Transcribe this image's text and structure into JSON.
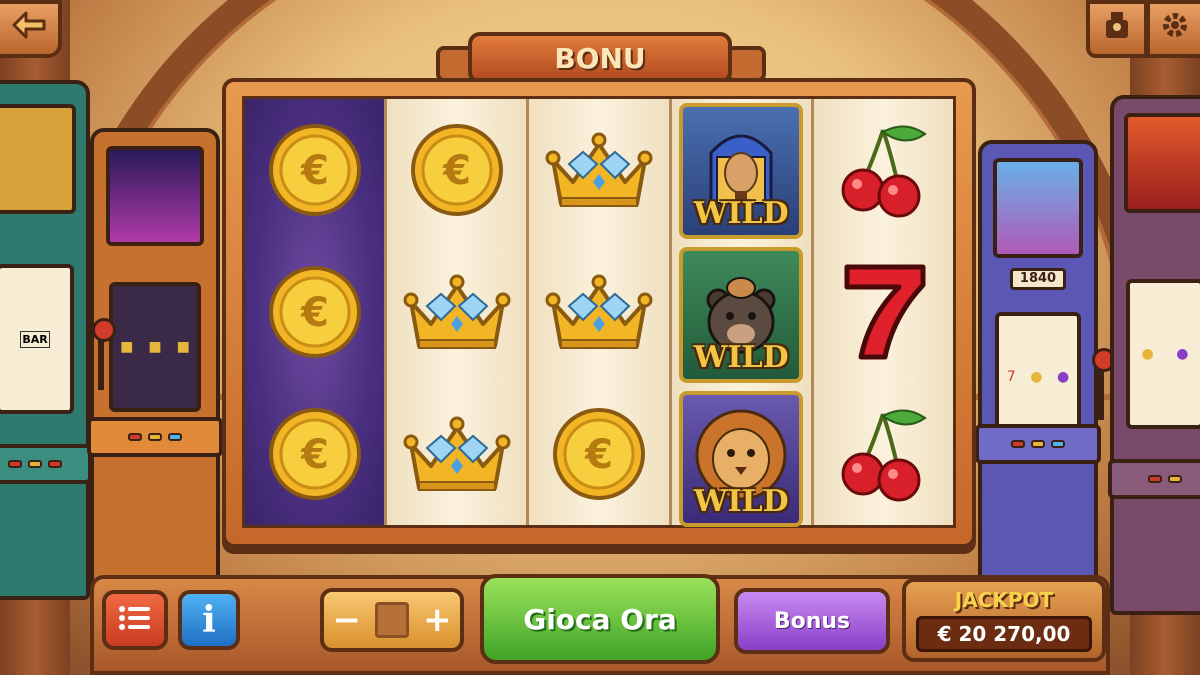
{
  "banner": {
    "title": "BONU"
  },
  "reels": [
    {
      "style": "purple",
      "symbols": [
        "euro-coin",
        "euro-coin",
        "euro-coin"
      ]
    },
    {
      "style": "cream",
      "symbols": [
        "euro-coin",
        "diamond-crown",
        "diamond-crown"
      ]
    },
    {
      "style": "cream",
      "symbols": [
        "diamond-crown",
        "diamond-crown",
        "euro-coin"
      ]
    },
    {
      "style": "wild",
      "symbols": [
        "pharaoh-wild",
        "bear-wild",
        "lion-wild"
      ],
      "wild_label": "WILD"
    },
    {
      "style": "cream",
      "symbols": [
        "cherries",
        "seven",
        "cherries"
      ]
    }
  ],
  "side_machines": {
    "right_front_label": "1840",
    "left_front_reel_text": "BAR"
  },
  "controls": {
    "play_label": "Gioca Ora",
    "bonus_label": "Bonus",
    "info_label": "i",
    "minus_label": "−",
    "plus_label": "+",
    "jackpot_label": "JACKPOT",
    "jackpot_amount": "€ 20 270,00"
  },
  "icons": {
    "back": "back-arrow-icon",
    "profile": "character-icon",
    "settings": "gear-icon",
    "menu": "list-menu-icon"
  },
  "colors": {
    "play": "#3fa427",
    "bonus": "#8a3fc8",
    "info": "#1f6fc4",
    "menu": "#c93b20",
    "frame": "#5c2e14"
  }
}
